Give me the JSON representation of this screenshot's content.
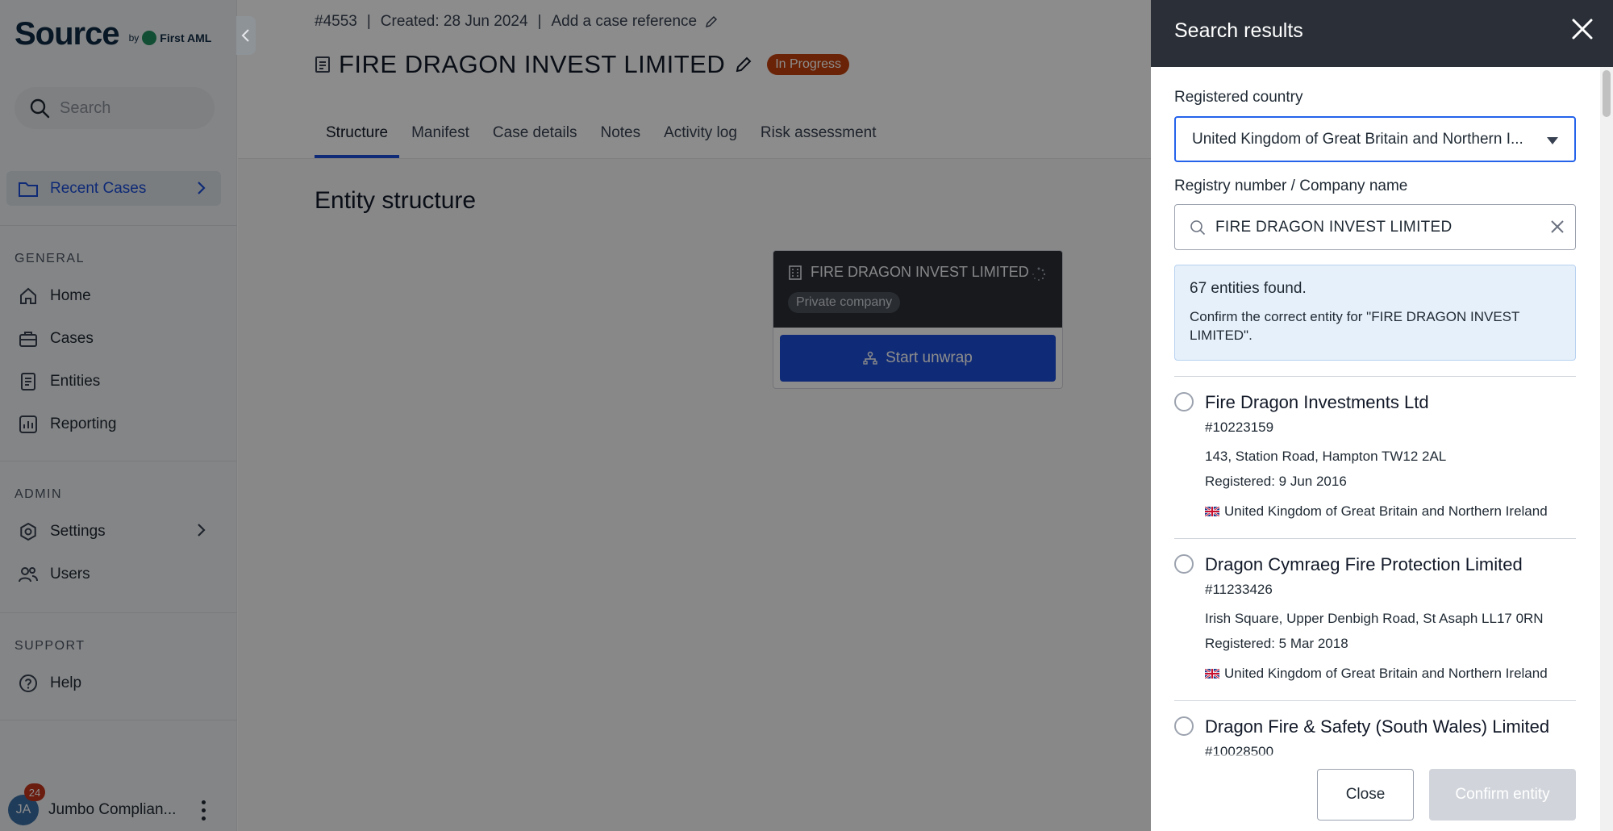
{
  "app": {
    "logo": {
      "word": "Source",
      "by": "by",
      "brand": "First AML"
    },
    "search_placeholder": "Search"
  },
  "sidebar": {
    "recent_cases_label": "Recent Cases",
    "general_label": "GENERAL",
    "general_items": [
      {
        "label": "Home",
        "icon": "home-icon"
      },
      {
        "label": "Cases",
        "icon": "briefcase-icon"
      },
      {
        "label": "Entities",
        "icon": "document-icon"
      },
      {
        "label": "Reporting",
        "icon": "chart-icon"
      }
    ],
    "admin_label": "ADMIN",
    "admin_items": [
      {
        "label": "Settings",
        "icon": "gear-icon"
      },
      {
        "label": "Users",
        "icon": "users-icon"
      }
    ],
    "support_label": "SUPPORT",
    "support_items": [
      {
        "label": "Help",
        "icon": "help-icon"
      }
    ],
    "user": {
      "initials": "JA",
      "name": "Jumbo Complian...",
      "notifications": "24"
    }
  },
  "case": {
    "id": "#4553",
    "created": "Created: 28 Jun 2024",
    "reference_link": "Add a case reference",
    "title": "FIRE DRAGON INVEST LIMITED",
    "status": "In Progress",
    "tabs": [
      "Structure",
      "Manifest",
      "Case details",
      "Notes",
      "Activity log",
      "Risk assessment"
    ],
    "active_tab": "Structure",
    "section_title": "Entity structure",
    "node": {
      "name": "FIRE DRAGON INVEST LIMITED",
      "type": "Private company",
      "action": "Start unwrap"
    }
  },
  "drawer": {
    "title": "Search results",
    "country_label": "Registered country",
    "country_value": "United Kingdom of Great Britain and Northern I...",
    "registry_label": "Registry number / Company name",
    "registry_value": "FIRE DRAGON INVEST LIMITED",
    "info_count": "67 entities found.",
    "info_message": "Confirm the correct entity for \"FIRE DRAGON INVEST LIMITED\".",
    "results": [
      {
        "name": "Fire Dragon Investments Ltd",
        "number": "#10223159",
        "address": "143, Station Road, Hampton TW12 2AL",
        "registered": "Registered: 9 Jun 2016",
        "country": "United Kingdom of Great Britain and Northern Ireland"
      },
      {
        "name": "Dragon Cymraeg Fire Protection Limited",
        "number": "#11233426",
        "address": "Irish Square, Upper Denbigh Road, St Asaph LL17 0RN",
        "registered": "Registered: 5 Mar 2018",
        "country": "United Kingdom of Great Britain and Northern Ireland"
      },
      {
        "name": "Dragon Fire & Safety (South Wales) Limited",
        "number": "#10028500",
        "address": "",
        "registered": "",
        "country": ""
      }
    ],
    "close_label": "Close",
    "confirm_label": "Confirm entity"
  },
  "colors": {
    "accent": "#1d4ed8",
    "status": "#c2410c",
    "drawer_header": "#2b3038",
    "info_bg": "#e6f0fb"
  }
}
